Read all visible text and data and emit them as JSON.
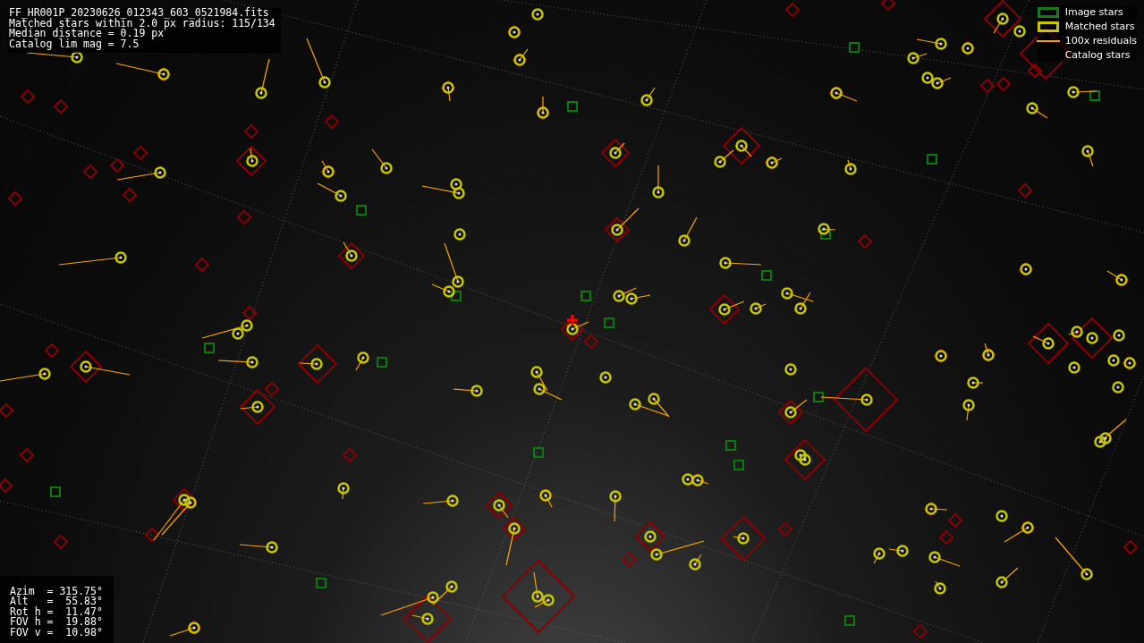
{
  "header_lines": [
    "FF_HR001P_20230626_012343_603_0521984.fits",
    "Matched stars within 2.0 px radius: 115/134",
    "Median distance = 0.19 px",
    "Catalog lim mag = 7.5"
  ],
  "legend": [
    {
      "kind": "box",
      "label": "Image stars",
      "color": "#1a7a1a"
    },
    {
      "kind": "box",
      "label": "Matched stars",
      "color": "#c8c800"
    },
    {
      "kind": "line",
      "label": "100x residuals",
      "color": "#ffa500"
    },
    {
      "kind": "none",
      "label": "Catalog stars"
    }
  ],
  "pointing_lines": [
    "Azim  = 315.75°",
    "Alt   =  55.83°",
    "Rot h =  11.47°",
    "FOV h =  19.88°",
    "FOV v =  10.98°"
  ]
}
